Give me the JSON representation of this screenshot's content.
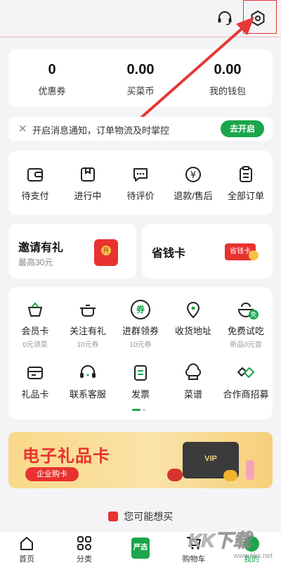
{
  "stats": [
    {
      "value": "0",
      "label": "优惠券"
    },
    {
      "value": "0.00",
      "label": "买菜币"
    },
    {
      "value": "0.00",
      "label": "我的钱包"
    }
  ],
  "notification": {
    "text": "开启消息通知，订单物流及时掌控",
    "button": "去开启"
  },
  "orders": [
    {
      "label": "待支付",
      "icon": "wallet-icon"
    },
    {
      "label": "进行中",
      "icon": "box-icon"
    },
    {
      "label": "待评价",
      "icon": "comment-icon"
    },
    {
      "label": "退款/售后",
      "icon": "refund-icon"
    },
    {
      "label": "全部订单",
      "icon": "clipboard-icon"
    }
  ],
  "promo_invite": {
    "title": "邀请有礼",
    "subtitle": "最高30元",
    "envelope_char": "开"
  },
  "promo_save": {
    "title": "省钱卡",
    "badge": "省钱卡"
  },
  "services": [
    {
      "label": "会员卡",
      "sub": "0元领菜",
      "icon": "basket-icon"
    },
    {
      "label": "关注有礼",
      "sub": "10元券",
      "icon": "pot-icon"
    },
    {
      "label": "进群领券",
      "sub": "10元券",
      "icon": "coupon-icon",
      "glyph": "券"
    },
    {
      "label": "收货地址",
      "sub": "",
      "icon": "location-icon"
    },
    {
      "label": "免费试吃",
      "sub": "新品0元尝",
      "icon": "bowl-icon",
      "glyph": "免"
    },
    {
      "label": "礼品卡",
      "sub": "",
      "icon": "card-icon"
    },
    {
      "label": "联系客服",
      "sub": "",
      "icon": "headset-icon"
    },
    {
      "label": "发票",
      "sub": "",
      "icon": "invoice-icon"
    },
    {
      "label": "菜谱",
      "sub": "",
      "icon": "chef-hat-icon"
    },
    {
      "label": "合作商招募",
      "sub": "",
      "icon": "handshake-icon"
    }
  ],
  "banner": {
    "title": "电子礼品卡",
    "subtitle": "企业购卡",
    "card_text": "VIP"
  },
  "recommend": {
    "label": "您可能想买"
  },
  "tabs": [
    {
      "label": "首页"
    },
    {
      "label": "分类"
    },
    {
      "label": "严选"
    },
    {
      "label": "购物车"
    },
    {
      "label": "我的"
    }
  ],
  "watermark": {
    "brand": "KK下载",
    "url": "www.kkx.net"
  },
  "colors": {
    "green": "#1aa64a",
    "arrow": "#e53935",
    "banner": "#f39a1e"
  }
}
